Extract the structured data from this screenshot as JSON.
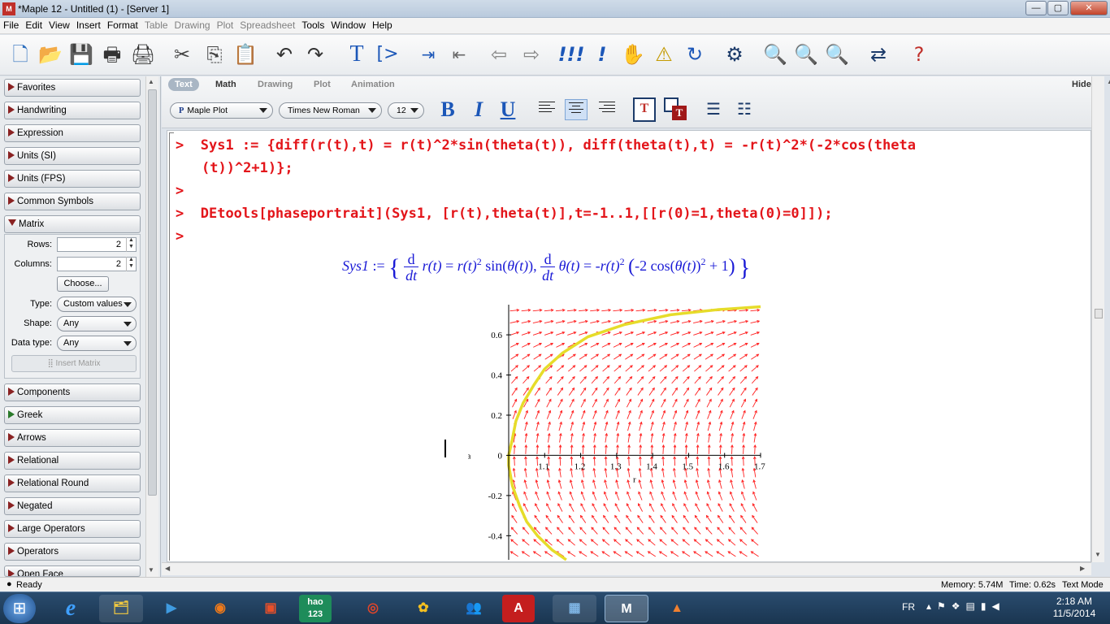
{
  "window": {
    "title": "*Maple 12 - Untitled (1) - [Server 1]",
    "buttons": {
      "minimize": "—",
      "maximize": "▢",
      "close": "✕"
    }
  },
  "menu": {
    "items": [
      {
        "label": "File",
        "enabled": true
      },
      {
        "label": "Edit",
        "enabled": true
      },
      {
        "label": "View",
        "enabled": true
      },
      {
        "label": "Insert",
        "enabled": true
      },
      {
        "label": "Format",
        "enabled": true
      },
      {
        "label": "Table",
        "enabled": false
      },
      {
        "label": "Drawing",
        "enabled": false
      },
      {
        "label": "Plot",
        "enabled": false
      },
      {
        "label": "Spreadsheet",
        "enabled": false
      },
      {
        "label": "Tools",
        "enabled": true
      },
      {
        "label": "Window",
        "enabled": true
      },
      {
        "label": "Help",
        "enabled": true
      }
    ]
  },
  "toolbar": {
    "new_icon": "new-document-icon",
    "open_icon": "open-folder-icon",
    "save_icon": "save-icon",
    "print_icon": "print-icon",
    "print_preview_icon": "print-preview-icon",
    "cut_icon": "scissors-icon",
    "copy_icon": "copy-icon",
    "paste_icon": "paste-icon",
    "undo_icon": "undo-icon",
    "redo_icon": "redo-icon",
    "text_label": "T",
    "prompt_label": "[>",
    "execute_all_label": "!!!",
    "execute_label": "!"
  },
  "palette": {
    "favorites": "Favorites",
    "handwriting": "Handwriting",
    "expression": "Expression",
    "units_si": "Units (SI)",
    "units_fps": "Units (FPS)",
    "common_symbols": "Common Symbols",
    "matrix": {
      "title": "Matrix",
      "rows_label": "Rows:",
      "rows_value": "2",
      "columns_label": "Columns:",
      "columns_value": "2",
      "choose_label": "Choose...",
      "type_label": "Type:",
      "type_value": "Custom values",
      "shape_label": "Shape:",
      "shape_value": "Any",
      "datatype_label": "Data type:",
      "datatype_value": "Any",
      "insert_label": "Insert Matrix"
    },
    "components": "Components",
    "greek": "Greek",
    "arrows": "Arrows",
    "relational": "Relational",
    "relational_round": "Relational Round",
    "negated": "Negated",
    "large_operators": "Large Operators",
    "operators": "Operators",
    "open_face": "Open Face"
  },
  "context": {
    "tabs": {
      "text": "Text",
      "math": "Math",
      "drawing": "Drawing",
      "plot": "Plot",
      "animation": "Animation"
    },
    "hide": "Hide",
    "style": "Maple Plot",
    "style_icon": "P",
    "font": "Times New Roman",
    "size": "12",
    "bold": "B",
    "italic": "I",
    "underline": "U"
  },
  "document": {
    "prompt": ">",
    "line1a": "Sys1 := {diff(r(t),t) = r(t)^2*sin(theta(t)), diff(theta(t),t) = -r(t)^2*(-2*cos(theta",
    "line1b": "(t))^2+1)};",
    "line3": "DEtools[phaseportrait](Sys1, [r(t),theta(t)],t=-1..1,[[r(0)=1,theta(0)=0]]);",
    "output_lhs": "Sys1",
    "output_assign": ":=",
    "d": "d",
    "dt": "dt",
    "r_of_t": "r(t)",
    "sin": "sin",
    "cos": "cos",
    "theta_of_t": "θ(t)",
    "two": "2",
    "minus_two": "-2",
    "plus_one": "+ 1",
    "equals": "=",
    "minus": "-"
  },
  "chart_data": {
    "type": "scatter",
    "title": "",
    "xlabel": "r",
    "ylabel": "theta",
    "xlim": [
      1.0,
      1.7
    ],
    "ylim": [
      -0.52,
      0.75
    ],
    "xticks": [
      "1.1",
      "1.2",
      "1.3",
      "1.4",
      "1.5",
      "1.6",
      "1.7"
    ],
    "yticks": [
      "-0.4",
      "-0.2",
      "0",
      "0.2",
      "0.4",
      "0.6"
    ],
    "ytick_values": [
      -0.4,
      -0.2,
      0,
      0.2,
      0.4,
      0.6
    ],
    "xtick_values": [
      1.1,
      1.2,
      1.3,
      1.4,
      1.5,
      1.6,
      1.7
    ],
    "field_color": "#ff2020",
    "trajectory_color": "#e6dc2a",
    "trajectory": {
      "x": [
        1.16,
        1.12,
        1.08,
        1.05,
        1.03,
        1.01,
        1.0,
        1.0,
        1.01,
        1.02,
        1.04,
        1.07,
        1.1,
        1.15,
        1.22,
        1.32,
        1.45,
        1.58,
        1.7
      ],
      "y": [
        -0.52,
        -0.47,
        -0.4,
        -0.33,
        -0.25,
        -0.15,
        -0.05,
        0.0,
        0.08,
        0.17,
        0.26,
        0.35,
        0.43,
        0.51,
        0.59,
        0.65,
        0.7,
        0.725,
        0.74
      ]
    }
  },
  "status": {
    "ready": "Ready",
    "memory": "Memory: 5.74M",
    "time": "Time: 0.62s",
    "mode": "Text Mode"
  },
  "taskbar": {
    "lang": "FR",
    "time": "2:18 AM",
    "date": "11/5/2014",
    "hao": "hao 123"
  }
}
